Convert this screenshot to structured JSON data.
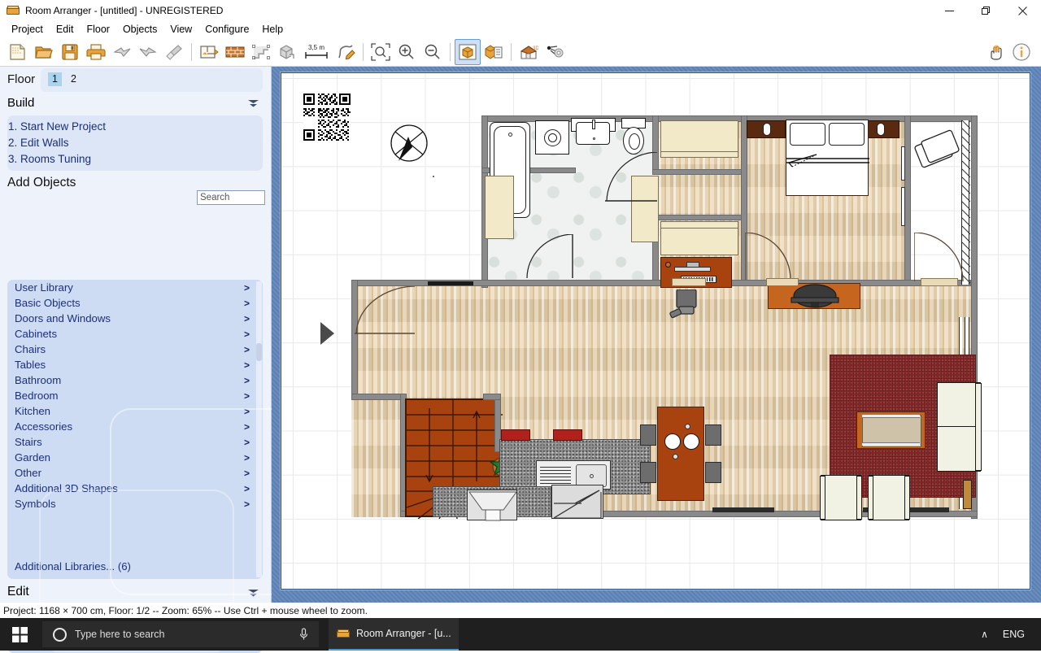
{
  "window": {
    "title": "Room Arranger - [untitled] - UNREGISTERED",
    "app_icon": "sofa-icon",
    "minimize": "—",
    "maximize": "❐",
    "close": "✕"
  },
  "menubar": {
    "items": [
      {
        "label": "Project"
      },
      {
        "label": "Edit"
      },
      {
        "label": "Floor"
      },
      {
        "label": "Objects"
      },
      {
        "label": "View"
      },
      {
        "label": "Configure"
      },
      {
        "label": "Help"
      }
    ]
  },
  "toolbar": {
    "buttons": [
      {
        "name": "new-project-icon",
        "title": "New"
      },
      {
        "name": "open-folder-icon",
        "title": "Open"
      },
      {
        "name": "save-disk-icon",
        "title": "Save"
      },
      {
        "name": "print-icon",
        "title": "Print"
      },
      {
        "name": "undo-icon",
        "title": "Undo"
      },
      {
        "name": "redo-icon",
        "title": "Redo"
      },
      {
        "name": "format-brush-icon",
        "title": "Format painter"
      },
      {
        "name": "room-plan-icon",
        "title": "Rooms"
      },
      {
        "name": "wall-brick-icon",
        "title": "Walls"
      },
      {
        "name": "stairs-icon",
        "title": "Stairs"
      },
      {
        "name": "object-3d-icon",
        "title": "Objects"
      },
      {
        "name": "measure-3-5m-icon",
        "title": "Measure",
        "label": "3,5 m"
      },
      {
        "name": "pencil-draw-icon",
        "title": "Draw"
      },
      {
        "name": "zoom-fit-icon",
        "title": "Zoom to fit"
      },
      {
        "name": "zoom-in-icon",
        "title": "Zoom in"
      },
      {
        "name": "zoom-out-icon",
        "title": "Zoom out"
      },
      {
        "name": "view-3d-box-icon",
        "title": "3D view",
        "selected": true
      },
      {
        "name": "view-list-icon",
        "title": "Object list"
      },
      {
        "name": "house-3d-icon",
        "title": "House view"
      },
      {
        "name": "render-icon",
        "title": "Render"
      },
      {
        "name": "hand-pan-icon",
        "title": "Pan"
      },
      {
        "name": "info-icon",
        "title": "Info"
      }
    ]
  },
  "sidebar": {
    "floor": {
      "label": "Floor",
      "tabs": [
        {
          "label": "1",
          "active": true
        },
        {
          "label": "2",
          "active": false
        }
      ]
    },
    "build": {
      "title": "Build",
      "collapse_icon": "chevron-down-icon",
      "links": [
        {
          "label": "1. Start New Project"
        },
        {
          "label": "2. Edit Walls"
        },
        {
          "label": "3. Rooms Tuning"
        }
      ]
    },
    "add_objects": {
      "title": "Add Objects",
      "search_placeholder": "Search",
      "search_value": "",
      "categories": [
        {
          "label": "User Library",
          "chevron": ">"
        },
        {
          "label": "Basic Objects",
          "chevron": ">"
        },
        {
          "label": "Doors and Windows",
          "chevron": ">"
        },
        {
          "label": "Cabinets",
          "chevron": ">"
        },
        {
          "label": "Chairs",
          "chevron": ">"
        },
        {
          "label": "Tables",
          "chevron": ">"
        },
        {
          "label": "Bathroom",
          "chevron": ">"
        },
        {
          "label": "Bedroom",
          "chevron": ">"
        },
        {
          "label": "Kitchen",
          "chevron": ">"
        },
        {
          "label": "Accessories",
          "chevron": ">"
        },
        {
          "label": "Stairs",
          "chevron": ">"
        },
        {
          "label": "Garden",
          "chevron": ">"
        },
        {
          "label": "Other",
          "chevron": ">"
        },
        {
          "label": "Additional 3D Shapes",
          "chevron": ">"
        },
        {
          "label": "Symbols",
          "chevron": ">"
        }
      ],
      "additional_libraries": "Additional Libraries... (6)"
    },
    "edit": {
      "title": "Edit",
      "collapse_icon": "chevron-down-icon"
    }
  },
  "canvas": {
    "expand_handle_icon": "expand-right-triangle-icon",
    "qr_code_icon": "qr-code-icon",
    "compass_icon": "compass-rose-icon",
    "zoom_percent": "65%"
  },
  "statusbar": {
    "text": "Project: 1168 × 700 cm, Floor: 1/2 -- Zoom: 65% -- Use Ctrl + mouse wheel to zoom."
  },
  "taskbar": {
    "start_icon": "windows-start-icon",
    "search_placeholder": "Type here to search",
    "search_circle_icon": "cortana-circle-icon",
    "mic_icon": "microphone-icon",
    "task": {
      "label": "Room Arranger - [u...",
      "icon": "sofa-icon"
    },
    "tray_chevron": "∧",
    "language": "ENG"
  },
  "colors": {
    "accent": "#5b80b4",
    "sidebar_bg": "#eef2fa",
    "link": "#1c2f7d",
    "wall": "#8a8a8a",
    "wood_floor": "#e6cfa8",
    "carpet": "#8e2a2a",
    "granite": "#8d8d8d",
    "furniture_wood": "#a8430f",
    "taskbar": "#1f1f1f"
  }
}
